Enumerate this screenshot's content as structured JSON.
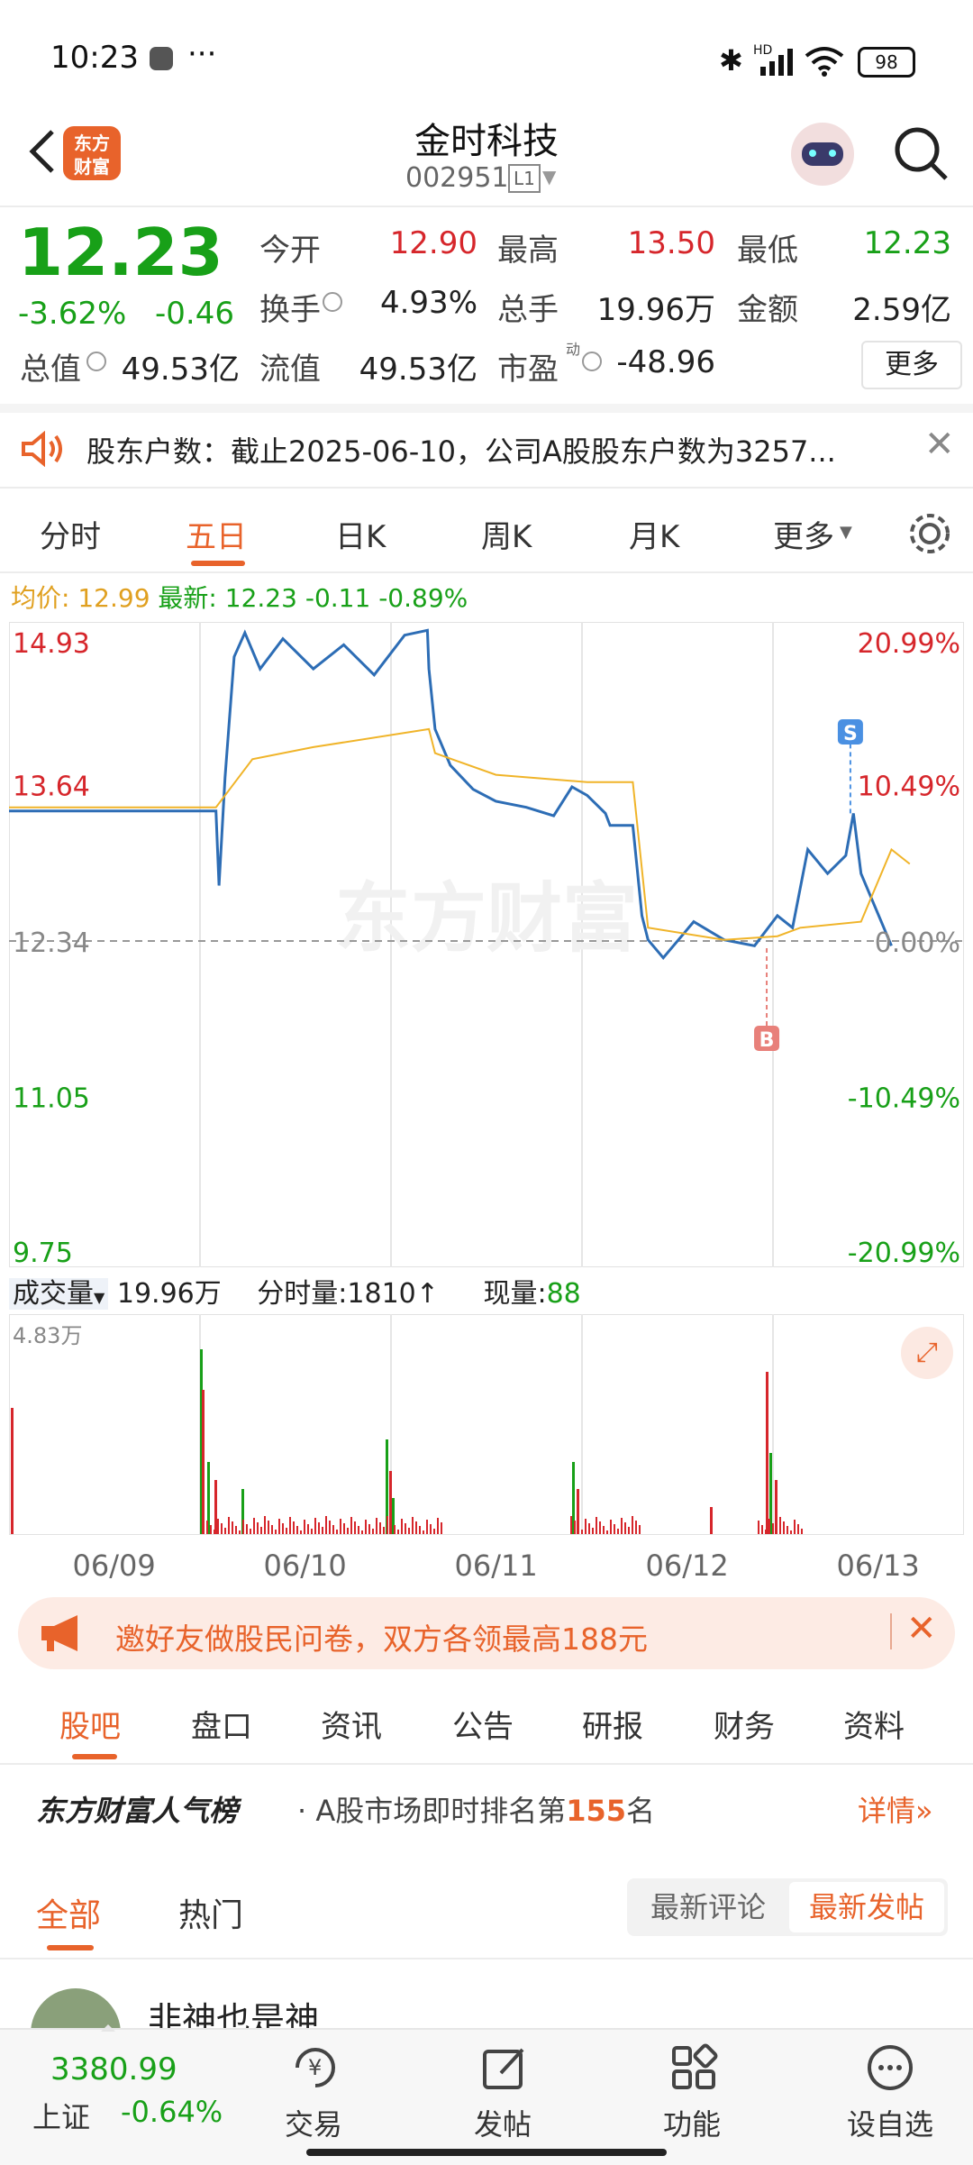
{
  "status_bar": {
    "time": "10:23",
    "dots": "···",
    "battery": "98",
    "hd": "HD"
  },
  "header": {
    "title": "金时科技",
    "code": "002951",
    "level": "L1",
    "brand_line1": "东方",
    "brand_line2": "财富"
  },
  "quote": {
    "price": "12.23",
    "change_pct": "-3.62%",
    "change": "-0.46",
    "open_label": "今开",
    "open": "12.90",
    "high_label": "最高",
    "high": "13.50",
    "low_label": "最低",
    "low": "12.23",
    "turnover_label": "换手",
    "turnover": "4.93%",
    "volume_label": "总手",
    "volume": "19.96万",
    "amount_label": "金额",
    "amount": "2.59亿",
    "mktcap_label": "总值",
    "mktcap": "49.53亿",
    "float_label": "流值",
    "float": "49.53亿",
    "pe_label": "市盈",
    "pe_sup": "动",
    "pe": "-48.96",
    "more_label": "更多"
  },
  "notice": {
    "text": "股东户数：截止2025-06-10，公司A股股东户数为3257..."
  },
  "chart_tabs": [
    "分时",
    "五日",
    "日K",
    "周K",
    "月K",
    "更多"
  ],
  "active_chart_tab": "五日",
  "chart_legend": {
    "avg_label": "均价:",
    "avg": "12.99",
    "latest_label": "最新:",
    "latest": "12.23",
    "latest_change": "-0.11",
    "latest_pct": "-0.89%"
  },
  "volume_bar": {
    "label": "成交量",
    "total": "19.96万",
    "time_vol_label": "分时量:",
    "time_vol": "1810",
    "arrow": "↑",
    "cur_label": "现量:",
    "cur": "88",
    "max_label": "4.83万"
  },
  "chart_data": {
    "type": "line",
    "price_axis": [
      "14.93",
      "13.64",
      "12.34",
      "11.05",
      "9.75"
    ],
    "pct_axis": [
      "20.99%",
      "10.49%",
      "0.00%",
      "-10.49%",
      "-20.99%"
    ],
    "x_labels": [
      "06/09",
      "06/10",
      "06/11",
      "06/12",
      "06/13"
    ],
    "ylim": [
      9.75,
      14.93
    ],
    "prev_close": 12.34,
    "colors": {
      "price": "#2d6db5",
      "avg": "#f0b429",
      "up": "#d6262b",
      "down": "#18a018"
    },
    "markers": [
      {
        "label": "S",
        "color": "#4a90e2"
      },
      {
        "label": "B",
        "color": "#e8807a"
      }
    ],
    "watermark": "东方财富"
  },
  "promo": {
    "text": "邀好友做股民问卷，双方各领最高188元"
  },
  "section_tabs": [
    "股吧",
    "盘口",
    "资讯",
    "公告",
    "研报",
    "财务",
    "资料"
  ],
  "active_section_tab": "股吧",
  "rank": {
    "brand": "东方财富人气榜",
    "prefix": "A股市场即时排名第",
    "num": "155",
    "suffix": "名",
    "detail": "详情"
  },
  "feed_tabs": {
    "all": "全部",
    "hot": "热门",
    "latest_comment": "最新评论",
    "latest_post": "最新发帖"
  },
  "post": {
    "author": "非神也是神"
  },
  "bottom_nav": {
    "index_value": "3380.99",
    "index_name": "上证",
    "index_change": "-0.64%",
    "items": [
      {
        "label": "交易"
      },
      {
        "label": "发帖"
      },
      {
        "label": "功能"
      },
      {
        "label": "设自选"
      }
    ]
  }
}
